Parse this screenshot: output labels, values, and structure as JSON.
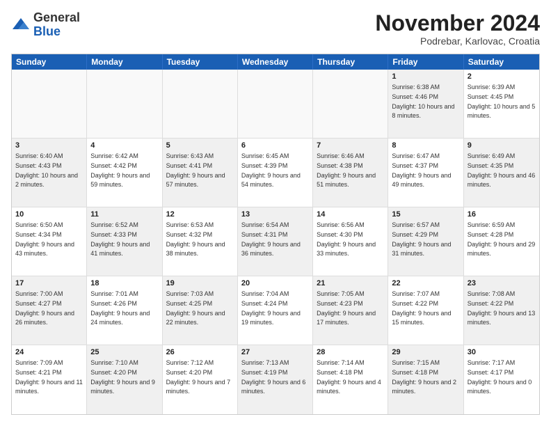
{
  "header": {
    "logo_general": "General",
    "logo_blue": "Blue",
    "month_title": "November 2024",
    "subtitle": "Podrebar, Karlovac, Croatia"
  },
  "calendar": {
    "days_of_week": [
      "Sunday",
      "Monday",
      "Tuesday",
      "Wednesday",
      "Thursday",
      "Friday",
      "Saturday"
    ],
    "weeks": [
      [
        {
          "day": "",
          "info": "",
          "empty": true
        },
        {
          "day": "",
          "info": "",
          "empty": true
        },
        {
          "day": "",
          "info": "",
          "empty": true
        },
        {
          "day": "",
          "info": "",
          "empty": true
        },
        {
          "day": "",
          "info": "",
          "empty": true
        },
        {
          "day": "1",
          "info": "Sunrise: 6:38 AM\nSunset: 4:46 PM\nDaylight: 10 hours and 8 minutes.",
          "shaded": true
        },
        {
          "day": "2",
          "info": "Sunrise: 6:39 AM\nSunset: 4:45 PM\nDaylight: 10 hours and 5 minutes.",
          "shaded": false
        }
      ],
      [
        {
          "day": "3",
          "info": "Sunrise: 6:40 AM\nSunset: 4:43 PM\nDaylight: 10 hours and 2 minutes.",
          "shaded": true
        },
        {
          "day": "4",
          "info": "Sunrise: 6:42 AM\nSunset: 4:42 PM\nDaylight: 9 hours and 59 minutes.",
          "shaded": false
        },
        {
          "day": "5",
          "info": "Sunrise: 6:43 AM\nSunset: 4:41 PM\nDaylight: 9 hours and 57 minutes.",
          "shaded": true
        },
        {
          "day": "6",
          "info": "Sunrise: 6:45 AM\nSunset: 4:39 PM\nDaylight: 9 hours and 54 minutes.",
          "shaded": false
        },
        {
          "day": "7",
          "info": "Sunrise: 6:46 AM\nSunset: 4:38 PM\nDaylight: 9 hours and 51 minutes.",
          "shaded": true
        },
        {
          "day": "8",
          "info": "Sunrise: 6:47 AM\nSunset: 4:37 PM\nDaylight: 9 hours and 49 minutes.",
          "shaded": false
        },
        {
          "day": "9",
          "info": "Sunrise: 6:49 AM\nSunset: 4:35 PM\nDaylight: 9 hours and 46 minutes.",
          "shaded": true
        }
      ],
      [
        {
          "day": "10",
          "info": "Sunrise: 6:50 AM\nSunset: 4:34 PM\nDaylight: 9 hours and 43 minutes.",
          "shaded": false
        },
        {
          "day": "11",
          "info": "Sunrise: 6:52 AM\nSunset: 4:33 PM\nDaylight: 9 hours and 41 minutes.",
          "shaded": true
        },
        {
          "day": "12",
          "info": "Sunrise: 6:53 AM\nSunset: 4:32 PM\nDaylight: 9 hours and 38 minutes.",
          "shaded": false
        },
        {
          "day": "13",
          "info": "Sunrise: 6:54 AM\nSunset: 4:31 PM\nDaylight: 9 hours and 36 minutes.",
          "shaded": true
        },
        {
          "day": "14",
          "info": "Sunrise: 6:56 AM\nSunset: 4:30 PM\nDaylight: 9 hours and 33 minutes.",
          "shaded": false
        },
        {
          "day": "15",
          "info": "Sunrise: 6:57 AM\nSunset: 4:29 PM\nDaylight: 9 hours and 31 minutes.",
          "shaded": true
        },
        {
          "day": "16",
          "info": "Sunrise: 6:59 AM\nSunset: 4:28 PM\nDaylight: 9 hours and 29 minutes.",
          "shaded": false
        }
      ],
      [
        {
          "day": "17",
          "info": "Sunrise: 7:00 AM\nSunset: 4:27 PM\nDaylight: 9 hours and 26 minutes.",
          "shaded": true
        },
        {
          "day": "18",
          "info": "Sunrise: 7:01 AM\nSunset: 4:26 PM\nDaylight: 9 hours and 24 minutes.",
          "shaded": false
        },
        {
          "day": "19",
          "info": "Sunrise: 7:03 AM\nSunset: 4:25 PM\nDaylight: 9 hours and 22 minutes.",
          "shaded": true
        },
        {
          "day": "20",
          "info": "Sunrise: 7:04 AM\nSunset: 4:24 PM\nDaylight: 9 hours and 19 minutes.",
          "shaded": false
        },
        {
          "day": "21",
          "info": "Sunrise: 7:05 AM\nSunset: 4:23 PM\nDaylight: 9 hours and 17 minutes.",
          "shaded": true
        },
        {
          "day": "22",
          "info": "Sunrise: 7:07 AM\nSunset: 4:22 PM\nDaylight: 9 hours and 15 minutes.",
          "shaded": false
        },
        {
          "day": "23",
          "info": "Sunrise: 7:08 AM\nSunset: 4:22 PM\nDaylight: 9 hours and 13 minutes.",
          "shaded": true
        }
      ],
      [
        {
          "day": "24",
          "info": "Sunrise: 7:09 AM\nSunset: 4:21 PM\nDaylight: 9 hours and 11 minutes.",
          "shaded": false
        },
        {
          "day": "25",
          "info": "Sunrise: 7:10 AM\nSunset: 4:20 PM\nDaylight: 9 hours and 9 minutes.",
          "shaded": true
        },
        {
          "day": "26",
          "info": "Sunrise: 7:12 AM\nSunset: 4:20 PM\nDaylight: 9 hours and 7 minutes.",
          "shaded": false
        },
        {
          "day": "27",
          "info": "Sunrise: 7:13 AM\nSunset: 4:19 PM\nDaylight: 9 hours and 6 minutes.",
          "shaded": true
        },
        {
          "day": "28",
          "info": "Sunrise: 7:14 AM\nSunset: 4:18 PM\nDaylight: 9 hours and 4 minutes.",
          "shaded": false
        },
        {
          "day": "29",
          "info": "Sunrise: 7:15 AM\nSunset: 4:18 PM\nDaylight: 9 hours and 2 minutes.",
          "shaded": true
        },
        {
          "day": "30",
          "info": "Sunrise: 7:17 AM\nSunset: 4:17 PM\nDaylight: 9 hours and 0 minutes.",
          "shaded": false
        }
      ]
    ]
  }
}
